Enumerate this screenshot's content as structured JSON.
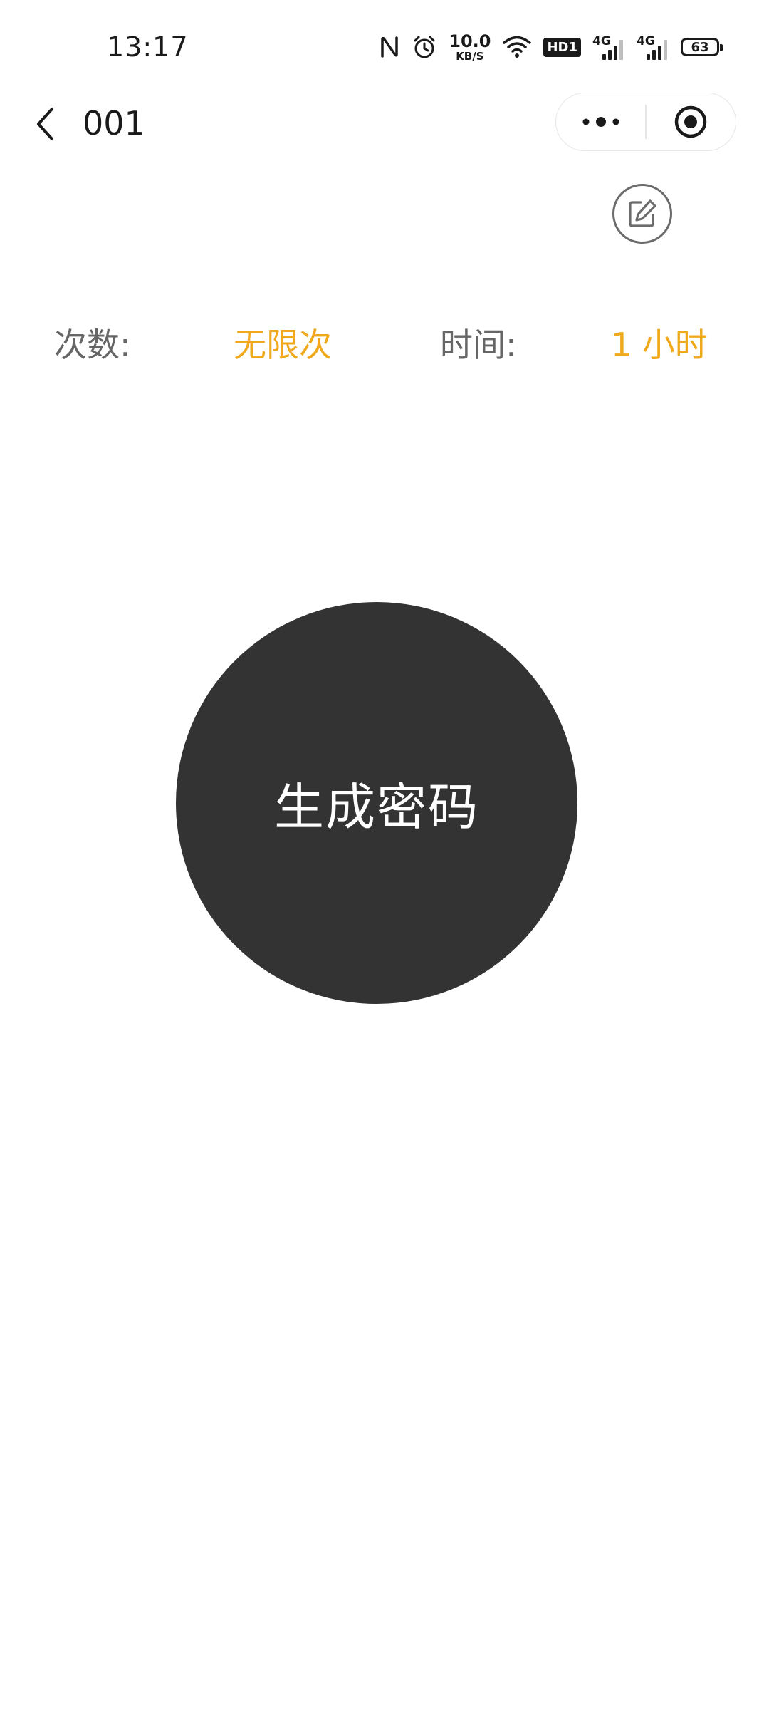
{
  "status_bar": {
    "time": "13:17",
    "net_speed_value": "10.0",
    "net_speed_unit": "KB/S",
    "hd_label": "HD1",
    "signal_1_label": "4G",
    "signal_2_label": "4G",
    "battery": "63"
  },
  "nav": {
    "title": "001"
  },
  "info": {
    "count_label": "次数:",
    "count_value": "无限次",
    "time_label": "时间:",
    "time_value": "1 小时"
  },
  "generate": {
    "label": "生成密码"
  },
  "icons": {
    "back": "chevron-left-icon",
    "more": "more-dots-icon",
    "close": "target-circle-icon",
    "edit": "edit-pencil-icon",
    "nfc": "nfc-icon",
    "alarm": "alarm-clock-icon",
    "wifi": "wifi-icon"
  },
  "colors": {
    "accent": "#f0a91d",
    "button_bg": "#333333",
    "label_gray": "#666666"
  }
}
